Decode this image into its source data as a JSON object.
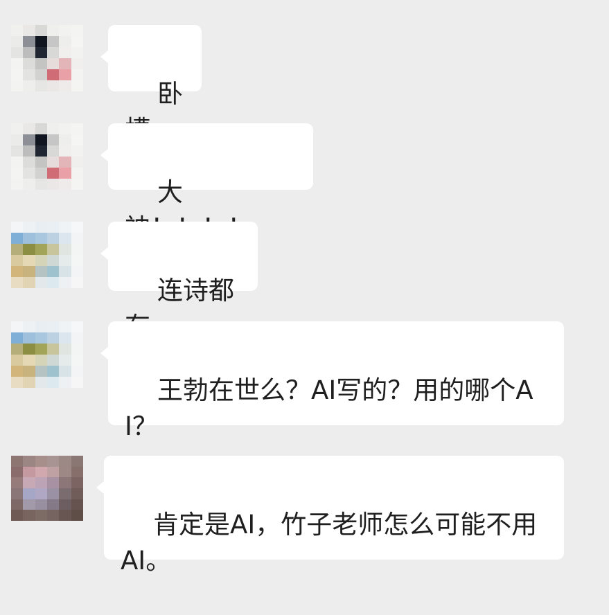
{
  "conversation": {
    "messages": [
      {
        "sender": "user-a",
        "text": "卧槽"
      },
      {
        "sender": "user-a",
        "text": "大神！！！！"
      },
      {
        "sender": "user-b",
        "text": "连诗都有"
      },
      {
        "sender": "user-b",
        "text": "王勃在世么？AI写的？用的哪个AI？"
      },
      {
        "sender": "user-c",
        "text": "肯定是AI，竹子老师怎么可能不用AI。"
      }
    ]
  },
  "colors": {
    "background": "#ededed",
    "bubble": "#ffffff",
    "text": "#1f1f1f"
  }
}
